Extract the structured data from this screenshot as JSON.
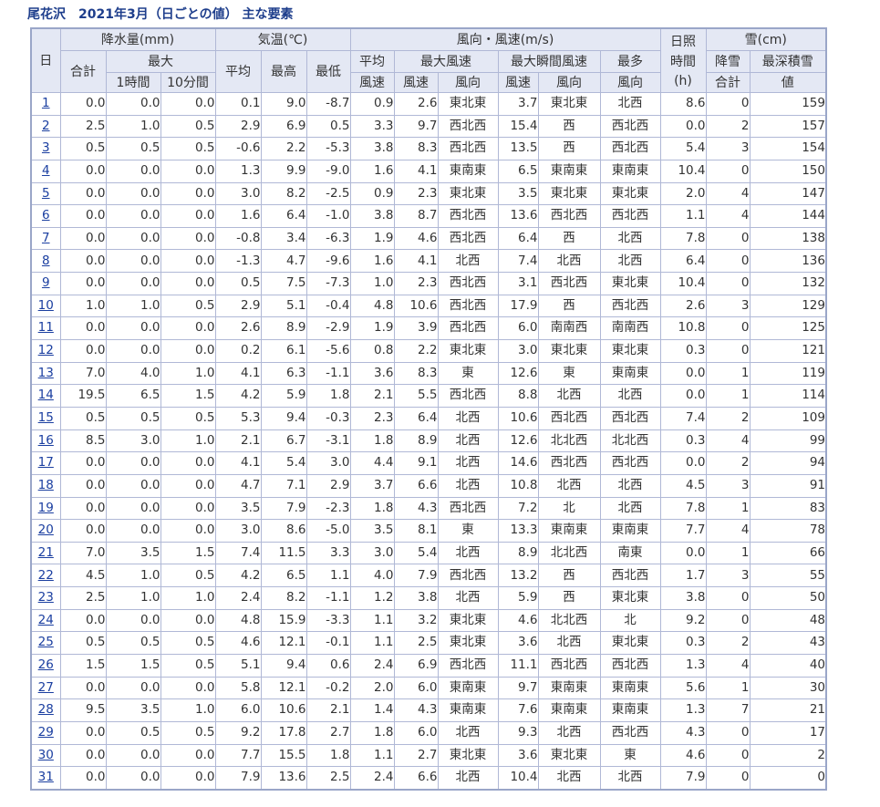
{
  "title": "尾花沢　2021年3月（日ごとの値）  主な要素",
  "headers": {
    "day": "日",
    "precip": "降水量(mm)",
    "total": "合計",
    "max": "最大",
    "one_hour": "1時間",
    "ten_min": "10分間",
    "temp": "気温(℃)",
    "avg": "平均",
    "highest": "最高",
    "lowest": "最低",
    "wind": "風向・風速(m/s)",
    "avg_wind_speed_1": "平均",
    "avg_wind_speed_2": "風速",
    "max_wind": "最大風速",
    "max_gust": "最大瞬間風速",
    "wind_speed": "風速",
    "wind_dir": "風向",
    "gust_speed": "風速",
    "gust_dir": "風向",
    "most_freq_1": "最多",
    "most_freq_2": "風向",
    "sunshine_1": "日照",
    "sunshine_2": "時間",
    "sunshine_3": "(h)",
    "snow": "雪(cm)",
    "snowfall_1": "降雪",
    "snowfall_2": "合計",
    "depth_1": "最深積雪",
    "depth_2": "値"
  },
  "rows": [
    {
      "day": "1",
      "p_total": "0.0",
      "p_1h": "0.0",
      "p_10m": "0.0",
      "t_avg": "0.1",
      "t_max": "9.0",
      "t_min": "-8.7",
      "w_avg": "0.9",
      "w_max": "2.6",
      "w_max_dir": "東北東",
      "g_max": "3.7",
      "g_dir": "東北東",
      "w_freq": "北西",
      "sun": "8.6",
      "snowfall": "0",
      "depth": "159"
    },
    {
      "day": "2",
      "p_total": "2.5",
      "p_1h": "1.0",
      "p_10m": "0.5",
      "t_avg": "2.9",
      "t_max": "6.9",
      "t_min": "0.5",
      "w_avg": "3.3",
      "w_max": "9.7",
      "w_max_dir": "西北西",
      "g_max": "15.4",
      "g_dir": "西",
      "w_freq": "西北西",
      "sun": "0.0",
      "snowfall": "2",
      "depth": "157"
    },
    {
      "day": "3",
      "p_total": "0.5",
      "p_1h": "0.5",
      "p_10m": "0.5",
      "t_avg": "-0.6",
      "t_max": "2.2",
      "t_min": "-5.3",
      "w_avg": "3.8",
      "w_max": "8.3",
      "w_max_dir": "西北西",
      "g_max": "13.5",
      "g_dir": "西",
      "w_freq": "西北西",
      "sun": "5.4",
      "snowfall": "3",
      "depth": "154"
    },
    {
      "day": "4",
      "p_total": "0.0",
      "p_1h": "0.0",
      "p_10m": "0.0",
      "t_avg": "1.3",
      "t_max": "9.9",
      "t_min": "-9.0",
      "w_avg": "1.6",
      "w_max": "4.1",
      "w_max_dir": "東南東",
      "g_max": "6.5",
      "g_dir": "東南東",
      "w_freq": "東南東",
      "sun": "10.4",
      "snowfall": "0",
      "depth": "150"
    },
    {
      "day": "5",
      "p_total": "0.0",
      "p_1h": "0.0",
      "p_10m": "0.0",
      "t_avg": "3.0",
      "t_max": "8.2",
      "t_min": "-2.5",
      "w_avg": "0.9",
      "w_max": "2.3",
      "w_max_dir": "東北東",
      "g_max": "3.5",
      "g_dir": "東北東",
      "w_freq": "東北東",
      "sun": "2.0",
      "snowfall": "4",
      "depth": "147"
    },
    {
      "day": "6",
      "p_total": "0.0",
      "p_1h": "0.0",
      "p_10m": "0.0",
      "t_avg": "1.6",
      "t_max": "6.4",
      "t_min": "-1.0",
      "w_avg": "3.8",
      "w_max": "8.7",
      "w_max_dir": "西北西",
      "g_max": "13.6",
      "g_dir": "西北西",
      "w_freq": "西北西",
      "sun": "1.1",
      "snowfall": "4",
      "depth": "144"
    },
    {
      "day": "7",
      "p_total": "0.0",
      "p_1h": "0.0",
      "p_10m": "0.0",
      "t_avg": "-0.8",
      "t_max": "3.4",
      "t_min": "-6.3",
      "w_avg": "1.9",
      "w_max": "4.6",
      "w_max_dir": "西北西",
      "g_max": "6.4",
      "g_dir": "西",
      "w_freq": "北西",
      "sun": "7.8",
      "snowfall": "0",
      "depth": "138"
    },
    {
      "day": "8",
      "p_total": "0.0",
      "p_1h": "0.0",
      "p_10m": "0.0",
      "t_avg": "-1.3",
      "t_max": "4.7",
      "t_min": "-9.6",
      "w_avg": "1.6",
      "w_max": "4.1",
      "w_max_dir": "北西",
      "g_max": "7.4",
      "g_dir": "北西",
      "w_freq": "北西",
      "sun": "6.4",
      "snowfall": "0",
      "depth": "136"
    },
    {
      "day": "9",
      "p_total": "0.0",
      "p_1h": "0.0",
      "p_10m": "0.0",
      "t_avg": "0.5",
      "t_max": "7.5",
      "t_min": "-7.3",
      "w_avg": "1.0",
      "w_max": "2.3",
      "w_max_dir": "西北西",
      "g_max": "3.1",
      "g_dir": "西北西",
      "w_freq": "東北東",
      "sun": "10.4",
      "snowfall": "0",
      "depth": "132"
    },
    {
      "day": "10",
      "p_total": "1.0",
      "p_1h": "1.0",
      "p_10m": "0.5",
      "t_avg": "2.9",
      "t_max": "5.1",
      "t_min": "-0.4",
      "w_avg": "4.8",
      "w_max": "10.6",
      "w_max_dir": "西北西",
      "g_max": "17.9",
      "g_dir": "西",
      "w_freq": "西北西",
      "sun": "2.6",
      "snowfall": "3",
      "depth": "129"
    },
    {
      "day": "11",
      "p_total": "0.0",
      "p_1h": "0.0",
      "p_10m": "0.0",
      "t_avg": "2.6",
      "t_max": "8.9",
      "t_min": "-2.9",
      "w_avg": "1.9",
      "w_max": "3.9",
      "w_max_dir": "西北西",
      "g_max": "6.0",
      "g_dir": "南南西",
      "w_freq": "南南西",
      "sun": "10.8",
      "snowfall": "0",
      "depth": "125"
    },
    {
      "day": "12",
      "p_total": "0.0",
      "p_1h": "0.0",
      "p_10m": "0.0",
      "t_avg": "0.2",
      "t_max": "6.1",
      "t_min": "-5.6",
      "w_avg": "0.8",
      "w_max": "2.2",
      "w_max_dir": "東北東",
      "g_max": "3.0",
      "g_dir": "東北東",
      "w_freq": "東北東",
      "sun": "0.3",
      "snowfall": "0",
      "depth": "121"
    },
    {
      "day": "13",
      "p_total": "7.0",
      "p_1h": "4.0",
      "p_10m": "1.0",
      "t_avg": "4.1",
      "t_max": "6.3",
      "t_min": "-1.1",
      "w_avg": "3.6",
      "w_max": "8.3",
      "w_max_dir": "東",
      "g_max": "12.6",
      "g_dir": "東",
      "w_freq": "東南東",
      "sun": "0.0",
      "snowfall": "1",
      "depth": "119"
    },
    {
      "day": "14",
      "p_total": "19.5",
      "p_1h": "6.5",
      "p_10m": "1.5",
      "t_avg": "4.2",
      "t_max": "5.9",
      "t_min": "1.8",
      "w_avg": "2.1",
      "w_max": "5.5",
      "w_max_dir": "西北西",
      "g_max": "8.8",
      "g_dir": "北西",
      "w_freq": "北西",
      "sun": "0.0",
      "snowfall": "1",
      "depth": "114"
    },
    {
      "day": "15",
      "p_total": "0.5",
      "p_1h": "0.5",
      "p_10m": "0.5",
      "t_avg": "5.3",
      "t_max": "9.4",
      "t_min": "-0.3",
      "w_avg": "2.3",
      "w_max": "6.4",
      "w_max_dir": "北西",
      "g_max": "10.6",
      "g_dir": "西北西",
      "w_freq": "西北西",
      "sun": "7.4",
      "snowfall": "2",
      "depth": "109"
    },
    {
      "day": "16",
      "p_total": "8.5",
      "p_1h": "3.0",
      "p_10m": "1.0",
      "t_avg": "2.1",
      "t_max": "6.7",
      "t_min": "-3.1",
      "w_avg": "1.8",
      "w_max": "8.9",
      "w_max_dir": "北西",
      "g_max": "12.6",
      "g_dir": "北北西",
      "w_freq": "北北西",
      "sun": "0.3",
      "snowfall": "4",
      "depth": "99"
    },
    {
      "day": "17",
      "p_total": "0.0",
      "p_1h": "0.0",
      "p_10m": "0.0",
      "t_avg": "4.1",
      "t_max": "5.4",
      "t_min": "3.0",
      "w_avg": "4.4",
      "w_max": "9.1",
      "w_max_dir": "北西",
      "g_max": "14.6",
      "g_dir": "西北西",
      "w_freq": "西北西",
      "sun": "0.0",
      "snowfall": "2",
      "depth": "94"
    },
    {
      "day": "18",
      "p_total": "0.0",
      "p_1h": "0.0",
      "p_10m": "0.0",
      "t_avg": "4.7",
      "t_max": "7.1",
      "t_min": "2.9",
      "w_avg": "3.7",
      "w_max": "6.6",
      "w_max_dir": "北西",
      "g_max": "10.8",
      "g_dir": "北西",
      "w_freq": "北西",
      "sun": "4.5",
      "snowfall": "3",
      "depth": "91"
    },
    {
      "day": "19",
      "p_total": "0.0",
      "p_1h": "0.0",
      "p_10m": "0.0",
      "t_avg": "3.5",
      "t_max": "7.9",
      "t_min": "-2.3",
      "w_avg": "1.8",
      "w_max": "4.3",
      "w_max_dir": "西北西",
      "g_max": "7.2",
      "g_dir": "北",
      "w_freq": "北西",
      "sun": "7.8",
      "snowfall": "1",
      "depth": "83"
    },
    {
      "day": "20",
      "p_total": "0.0",
      "p_1h": "0.0",
      "p_10m": "0.0",
      "t_avg": "3.0",
      "t_max": "8.6",
      "t_min": "-5.0",
      "w_avg": "3.5",
      "w_max": "8.1",
      "w_max_dir": "東",
      "g_max": "13.3",
      "g_dir": "東南東",
      "w_freq": "東南東",
      "sun": "7.7",
      "snowfall": "4",
      "depth": "78"
    },
    {
      "day": "21",
      "p_total": "7.0",
      "p_1h": "3.5",
      "p_10m": "1.5",
      "t_avg": "7.4",
      "t_max": "11.5",
      "t_min": "3.3",
      "w_avg": "3.0",
      "w_max": "5.4",
      "w_max_dir": "北西",
      "g_max": "8.9",
      "g_dir": "北北西",
      "w_freq": "南東",
      "sun": "0.0",
      "snowfall": "1",
      "depth": "66"
    },
    {
      "day": "22",
      "p_total": "4.5",
      "p_1h": "1.0",
      "p_10m": "0.5",
      "t_avg": "4.2",
      "t_max": "6.5",
      "t_min": "1.1",
      "w_avg": "4.0",
      "w_max": "7.9",
      "w_max_dir": "西北西",
      "g_max": "13.2",
      "g_dir": "西",
      "w_freq": "西北西",
      "sun": "1.7",
      "snowfall": "3",
      "depth": "55"
    },
    {
      "day": "23",
      "p_total": "2.5",
      "p_1h": "1.0",
      "p_10m": "1.0",
      "t_avg": "2.4",
      "t_max": "8.2",
      "t_min": "-1.1",
      "w_avg": "1.2",
      "w_max": "3.8",
      "w_max_dir": "北西",
      "g_max": "5.9",
      "g_dir": "西",
      "w_freq": "東北東",
      "sun": "3.8",
      "snowfall": "0",
      "depth": "50"
    },
    {
      "day": "24",
      "p_total": "0.0",
      "p_1h": "0.0",
      "p_10m": "0.0",
      "t_avg": "4.8",
      "t_max": "15.9",
      "t_min": "-3.3",
      "w_avg": "1.1",
      "w_max": "3.2",
      "w_max_dir": "東北東",
      "g_max": "4.6",
      "g_dir": "北北西",
      "w_freq": "北",
      "sun": "9.2",
      "snowfall": "0",
      "depth": "48"
    },
    {
      "day": "25",
      "p_total": "0.5",
      "p_1h": "0.5",
      "p_10m": "0.5",
      "t_avg": "4.6",
      "t_max": "12.1",
      "t_min": "-0.1",
      "w_avg": "1.1",
      "w_max": "2.5",
      "w_max_dir": "東北東",
      "g_max": "3.6",
      "g_dir": "北西",
      "w_freq": "東北東",
      "sun": "0.3",
      "snowfall": "2",
      "depth": "43"
    },
    {
      "day": "26",
      "p_total": "1.5",
      "p_1h": "1.5",
      "p_10m": "0.5",
      "t_avg": "5.1",
      "t_max": "9.4",
      "t_min": "0.6",
      "w_avg": "2.4",
      "w_max": "6.9",
      "w_max_dir": "西北西",
      "g_max": "11.1",
      "g_dir": "西北西",
      "w_freq": "西北西",
      "sun": "1.3",
      "snowfall": "4",
      "depth": "40"
    },
    {
      "day": "27",
      "p_total": "0.0",
      "p_1h": "0.0",
      "p_10m": "0.0",
      "t_avg": "5.8",
      "t_max": "12.1",
      "t_min": "-0.2",
      "w_avg": "2.0",
      "w_max": "6.0",
      "w_max_dir": "東南東",
      "g_max": "9.7",
      "g_dir": "東南東",
      "w_freq": "東南東",
      "sun": "5.6",
      "snowfall": "1",
      "depth": "30"
    },
    {
      "day": "28",
      "p_total": "9.5",
      "p_1h": "3.5",
      "p_10m": "1.0",
      "t_avg": "6.0",
      "t_max": "10.6",
      "t_min": "2.1",
      "w_avg": "1.4",
      "w_max": "4.3",
      "w_max_dir": "東南東",
      "g_max": "7.6",
      "g_dir": "東南東",
      "w_freq": "東南東",
      "sun": "1.3",
      "snowfall": "7",
      "depth": "21"
    },
    {
      "day": "29",
      "p_total": "0.0",
      "p_1h": "0.5",
      "p_10m": "0.5",
      "t_avg": "9.2",
      "t_max": "17.8",
      "t_min": "2.7",
      "w_avg": "1.8",
      "w_max": "6.0",
      "w_max_dir": "北西",
      "g_max": "9.3",
      "g_dir": "北西",
      "w_freq": "西北西",
      "sun": "4.3",
      "snowfall": "0",
      "depth": "17"
    },
    {
      "day": "30",
      "p_total": "0.0",
      "p_1h": "0.0",
      "p_10m": "0.0",
      "t_avg": "7.7",
      "t_max": "15.5",
      "t_min": "1.8",
      "w_avg": "1.1",
      "w_max": "2.7",
      "w_max_dir": "東北東",
      "g_max": "3.6",
      "g_dir": "東北東",
      "w_freq": "東",
      "sun": "4.6",
      "snowfall": "0",
      "depth": "2"
    },
    {
      "day": "31",
      "p_total": "0.0",
      "p_1h": "0.0",
      "p_10m": "0.0",
      "t_avg": "7.9",
      "t_max": "13.6",
      "t_min": "2.5",
      "w_avg": "2.4",
      "w_max": "6.6",
      "w_max_dir": "北西",
      "g_max": "10.4",
      "g_dir": "北西",
      "w_freq": "北西",
      "sun": "7.9",
      "snowfall": "0",
      "depth": "0"
    }
  ],
  "colors": {
    "header_bg": "#e4e8f4",
    "border": "#b0b8d6",
    "link": "#1a3ea0",
    "title": "#1e3e8c",
    "highlight": "#e00000"
  }
}
